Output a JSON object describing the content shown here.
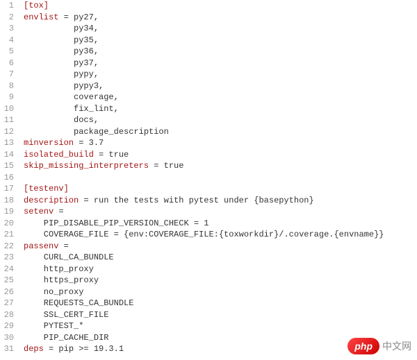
{
  "lines": [
    {
      "num": "1",
      "type": "header",
      "text": "[tox]"
    },
    {
      "num": "2",
      "type": "kv",
      "key": "envlist",
      "value": " = py27,"
    },
    {
      "num": "3",
      "type": "cont",
      "value": "          py34,"
    },
    {
      "num": "4",
      "type": "cont",
      "value": "          py35,"
    },
    {
      "num": "5",
      "type": "cont",
      "value": "          py36,"
    },
    {
      "num": "6",
      "type": "cont",
      "value": "          py37,"
    },
    {
      "num": "7",
      "type": "cont",
      "value": "          pypy,"
    },
    {
      "num": "8",
      "type": "cont",
      "value": "          pypy3,"
    },
    {
      "num": "9",
      "type": "cont",
      "value": "          coverage,"
    },
    {
      "num": "10",
      "type": "cont",
      "value": "          fix_lint,"
    },
    {
      "num": "11",
      "type": "cont",
      "value": "          docs,"
    },
    {
      "num": "12",
      "type": "cont",
      "value": "          package_description"
    },
    {
      "num": "13",
      "type": "kv",
      "key": "minversion",
      "value": " = 3.7"
    },
    {
      "num": "14",
      "type": "kv",
      "key": "isolated_build",
      "value": " = true"
    },
    {
      "num": "15",
      "type": "kv",
      "key": "skip_missing_interpreters",
      "value": " = true"
    },
    {
      "num": "16",
      "type": "blank",
      "value": ""
    },
    {
      "num": "17",
      "type": "header",
      "text": "[testenv]"
    },
    {
      "num": "18",
      "type": "kv",
      "key": "description",
      "value": " = run the tests with pytest under {basepython}"
    },
    {
      "num": "19",
      "type": "kv",
      "key": "setenv",
      "value": " ="
    },
    {
      "num": "20",
      "type": "cont",
      "value": "    PIP_DISABLE_PIP_VERSION_CHECK = 1"
    },
    {
      "num": "21",
      "type": "cont",
      "value": "    COVERAGE_FILE = {env:COVERAGE_FILE:{toxworkdir}/.coverage.{envname}}"
    },
    {
      "num": "22",
      "type": "kv",
      "key": "passenv",
      "value": " ="
    },
    {
      "num": "23",
      "type": "cont",
      "value": "    CURL_CA_BUNDLE"
    },
    {
      "num": "24",
      "type": "cont",
      "value": "    http_proxy"
    },
    {
      "num": "25",
      "type": "cont",
      "value": "    https_proxy"
    },
    {
      "num": "26",
      "type": "cont",
      "value": "    no_proxy"
    },
    {
      "num": "27",
      "type": "cont",
      "value": "    REQUESTS_CA_BUNDLE"
    },
    {
      "num": "28",
      "type": "cont",
      "value": "    SSL_CERT_FILE"
    },
    {
      "num": "29",
      "type": "cont",
      "value": "    PYTEST_*"
    },
    {
      "num": "30",
      "type": "cont",
      "value": "    PIP_CACHE_DIR"
    },
    {
      "num": "31",
      "type": "kv",
      "key": "deps",
      "value": " = pip >= 19.3.1"
    }
  ],
  "watermark": {
    "badge": "php",
    "text": "中文网"
  }
}
